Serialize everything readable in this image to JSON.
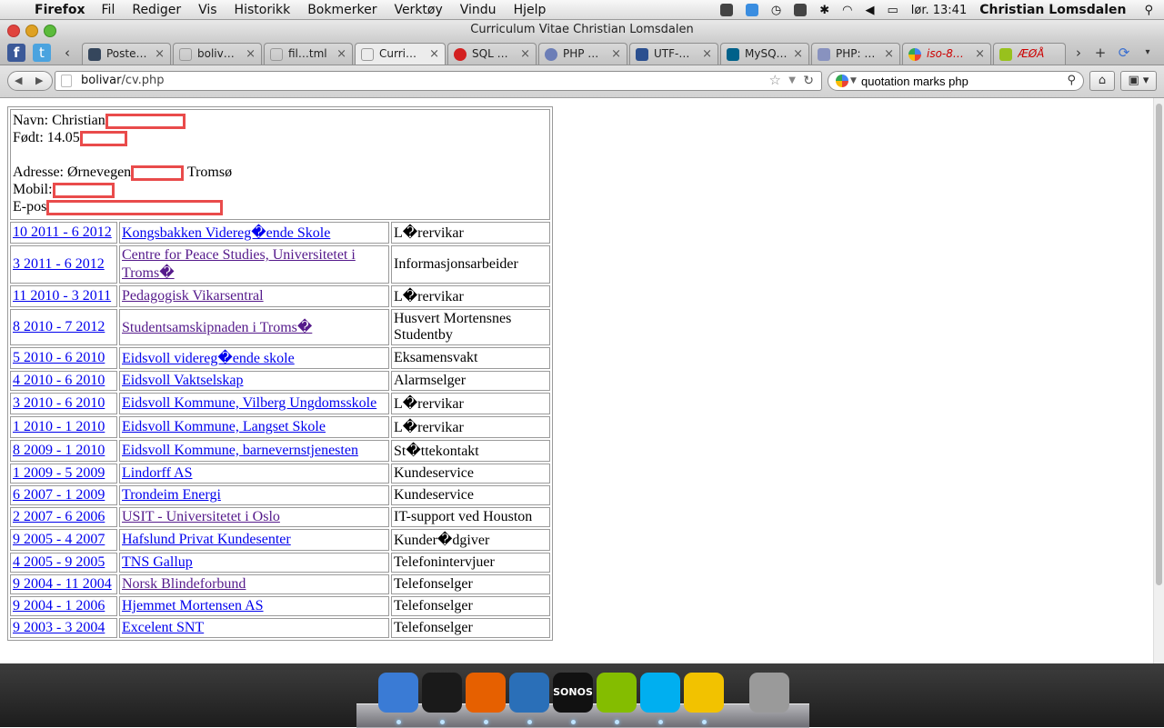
{
  "menubar": {
    "app_name": "Firefox",
    "menus": [
      "Fil",
      "Rediger",
      "Vis",
      "Historikk",
      "Bokmerker",
      "Verktøy",
      "Vindu",
      "Hjelp"
    ],
    "clock": "lør. 13:41",
    "user": "Christian Lomsdalen"
  },
  "window": {
    "title": "Curriculum Vitae Christian Lomsdalen"
  },
  "tabs": [
    {
      "label": "Poste…",
      "icon": "tumblr-icon"
    },
    {
      "label": "boliv…",
      "icon": "page-icon"
    },
    {
      "label": "fil…tml",
      "icon": "page-icon"
    },
    {
      "label": "Curri…",
      "icon": "page-icon",
      "active": true
    },
    {
      "label": "SQL …",
      "icon": "red-circle-icon"
    },
    {
      "label": "PHP …",
      "icon": "php-icon"
    },
    {
      "label": "UTF-…",
      "icon": "w-icon"
    },
    {
      "label": "MySQ…",
      "icon": "mysql-icon"
    },
    {
      "label": "PHP: …",
      "icon": "php-icon"
    },
    {
      "label": "iso-8…",
      "icon": "google-icon"
    },
    {
      "label": "ÆØÅ …",
      "icon": "android-icon"
    }
  ],
  "navbar": {
    "url_host": "bolivar",
    "url_path": "/cv.php",
    "search_query": "quotation marks php"
  },
  "cv": {
    "name_label": "Navn: Christian",
    "born_label": "Født: 14.05",
    "address_label": "Adresse: Ørnevegen",
    "address_city": "Tromsø",
    "mobile_label": "Mobil:",
    "email_label": "E-pos",
    "rows": [
      {
        "period": "10 2011 - 6 2012",
        "employer": "Kongsbakken Videreg�ende Skole",
        "role": "L�rervikar",
        "visited": false
      },
      {
        "period": "3 2011 - 6 2012",
        "employer": "Centre for Peace Studies, Universitetet i Troms�",
        "role": "Informasjonsarbeider",
        "visited": true
      },
      {
        "period": "11 2010 - 3 2011",
        "employer": "Pedagogisk Vikarsentral",
        "role": "L�rervikar",
        "visited": true
      },
      {
        "period": "8 2010 - 7 2012",
        "employer": "Studentsamskipnaden i Troms�",
        "role": "Husvert Mortensnes Studentby",
        "visited": true
      },
      {
        "period": "5 2010 - 6 2010",
        "employer": "Eidsvoll videreg�ende skole",
        "role": "Eksamensvakt",
        "visited": false
      },
      {
        "period": "4 2010 - 6 2010",
        "employer": "Eidsvoll Vaktselskap",
        "role": "Alarmselger",
        "visited": false
      },
      {
        "period": "3 2010 - 6 2010",
        "employer": "Eidsvoll Kommune, Vilberg Ungdomsskole",
        "role": "L�rervikar",
        "visited": false
      },
      {
        "period": "1 2010 - 1 2010",
        "employer": "Eidsvoll Kommune, Langset Skole",
        "role": "L�rervikar",
        "visited": false
      },
      {
        "period": "8 2009 - 1 2010",
        "employer": "Eidsvoll Kommune, barnevernstjenesten",
        "role": "St�ttekontakt",
        "visited": false
      },
      {
        "period": "1 2009 - 5 2009",
        "employer": "Lindorff AS",
        "role": "Kundeservice",
        "visited": false
      },
      {
        "period": "6 2007 - 1 2009",
        "employer": "Trondeim Energi",
        "role": "Kundeservice",
        "visited": false
      },
      {
        "period": "2 2007 - 6 2006",
        "employer": "USIT - Universitetet i Oslo",
        "role": "IT-support ved Houston",
        "visited": true
      },
      {
        "period": "9 2005 - 4 2007",
        "employer": "Hafslund Privat Kundesenter",
        "role": "Kunder�dgiver",
        "visited": false
      },
      {
        "period": "4 2005 - 9 2005",
        "employer": "TNS Gallup",
        "role": "Telefonintervjuer",
        "visited": false
      },
      {
        "period": "9 2004 - 11 2004",
        "employer": "Norsk Blindeforbund",
        "role": "Telefonselger",
        "visited": true
      },
      {
        "period": "9 2004 - 1 2006",
        "employer": "Hjemmet Mortensen AS",
        "role": "Telefonselger",
        "visited": false
      },
      {
        "period": "9 2003 - 3 2004",
        "employer": "Excelent SNT",
        "role": "Telefonselger",
        "visited": false
      }
    ]
  },
  "dock": [
    {
      "name": "finder-icon",
      "color": "#3a7bd5",
      "label": ""
    },
    {
      "name": "terminal-icon",
      "color": "#1a1a1a",
      "label": ""
    },
    {
      "name": "firefox-icon",
      "color": "#e66000",
      "label": ""
    },
    {
      "name": "thunderbird-icon",
      "color": "#2a6fb8",
      "label": ""
    },
    {
      "name": "sonos-icon",
      "color": "#111111",
      "label": "SONOS"
    },
    {
      "name": "spotify-icon",
      "color": "#84bd00",
      "label": ""
    },
    {
      "name": "skype-icon",
      "color": "#00aff0",
      "label": ""
    },
    {
      "name": "cyberduck-icon",
      "color": "#f2c200",
      "label": ""
    },
    {
      "name": "trash-icon",
      "color": "#9a9a9a",
      "label": ""
    }
  ]
}
